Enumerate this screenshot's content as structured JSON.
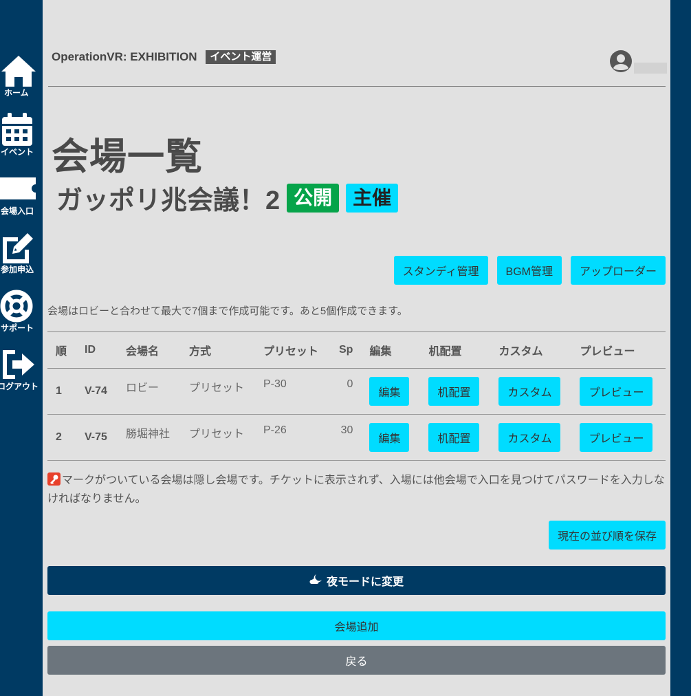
{
  "sidebar": {
    "items": [
      {
        "label": "ホーム",
        "icon": "home-icon"
      },
      {
        "label": "イベント",
        "icon": "calendar-icon"
      },
      {
        "label": "会場入口",
        "icon": "ticket-icon"
      },
      {
        "label": "参加申込",
        "icon": "edit-icon"
      },
      {
        "label": "サポート",
        "icon": "lifebuoy-icon"
      },
      {
        "label": "ログアウト",
        "icon": "logout-icon"
      }
    ]
  },
  "header": {
    "brand": "OperationVR: EXHIBITION",
    "badge": "イベント運営"
  },
  "page": {
    "title": "会場一覧",
    "event_name": "ガッポリ兆会議！2",
    "badge_public": "公開",
    "badge_host": "主催"
  },
  "toolbar": {
    "standee": "スタンディ管理",
    "bgm": "BGM管理",
    "uploader": "アップローダー"
  },
  "info_text": "会場はロビーと合わせて最大で7個まで作成可能です。あと5個作成できます。",
  "table": {
    "headers": [
      "順",
      "ID",
      "会場名",
      "方式",
      "プリセット",
      "Sp",
      "編集",
      "机配置",
      "カスタム",
      "プレビュー"
    ],
    "rows": [
      {
        "order": "1",
        "id": "V-74",
        "name": "ロビー",
        "method": "プリセット",
        "preset": "P-30",
        "sp": "0",
        "edit": "編集",
        "desk": "机配置",
        "custom": "カスタム",
        "preview": "プレビュー"
      },
      {
        "order": "2",
        "id": "V-75",
        "name": "勝堀神社",
        "method": "プリセット",
        "preset": "P-26",
        "sp": "30",
        "edit": "編集",
        "desk": "机配置",
        "custom": "カスタム",
        "preview": "プレビュー"
      }
    ]
  },
  "note": "マークがついている会場は隠し会場です。チケットに表示されず、入場には他会場で入口を見つけてパスワードを入力しなければなりません。",
  "buttons": {
    "save_order": "現在の並び順を保存",
    "night_mode": "夜モードに変更",
    "add_venue": "会場追加",
    "back": "戻る"
  },
  "colors": {
    "navy": "#003a63",
    "cyan": "#00dcff",
    "green": "#06a44a",
    "gray": "#6c757d",
    "background": "#e1e1e1"
  }
}
